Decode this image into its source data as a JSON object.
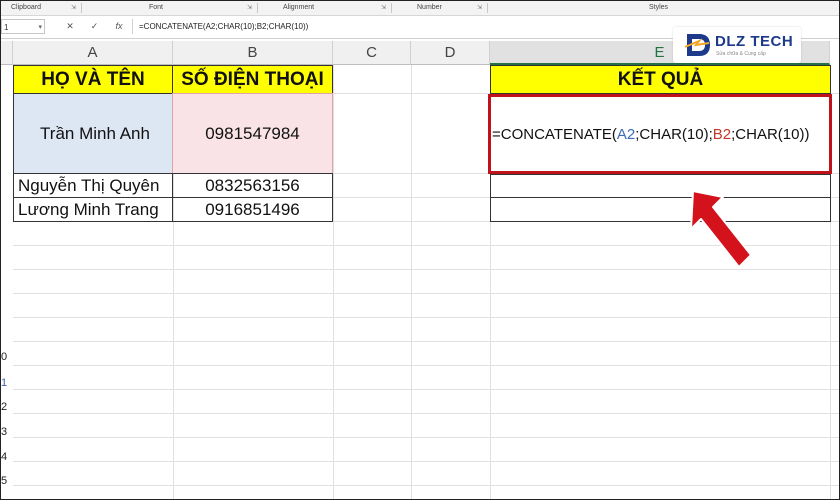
{
  "ribbon": {
    "groups": [
      "Clipboard",
      "Font",
      "Alignment",
      "Number",
      "Styles"
    ]
  },
  "formula_bar": {
    "name_box": "1",
    "cancel_icon": "✕",
    "enter_icon": "✓",
    "fx_label": "fx",
    "formula": "=CONCATENATE(A2;CHAR(10);B2;CHAR(10))"
  },
  "columns": [
    "A",
    "B",
    "C",
    "D",
    "E"
  ],
  "sheet": {
    "header_name": "HỌ VÀ TÊN",
    "header_phone": "SỐ ĐIỆN THOẠI",
    "header_result": "KẾT QUẢ",
    "rows": [
      {
        "name": "Trần Minh Anh",
        "phone": "0981547984"
      },
      {
        "name": "Nguyễn Thị Quyên",
        "phone": "0832563156"
      },
      {
        "name": "Lương Minh Trang",
        "phone": "0916851496"
      }
    ],
    "result_formula": {
      "p1": "=CONCATENATE(",
      "ref1": "A2",
      "p2": ";CHAR(10);",
      "ref2": "B2",
      "p3": ";CHAR(10))"
    }
  },
  "left_edge_numbers": [
    "0",
    "1",
    "2",
    "3",
    "4",
    "5"
  ],
  "logo": {
    "text": "DLZ TECH",
    "sub": "Sửa chữa & Cung cấp"
  },
  "colors": {
    "header_fill": "#ffff00",
    "highlight": "#c0121b",
    "excel_green": "#217346"
  }
}
